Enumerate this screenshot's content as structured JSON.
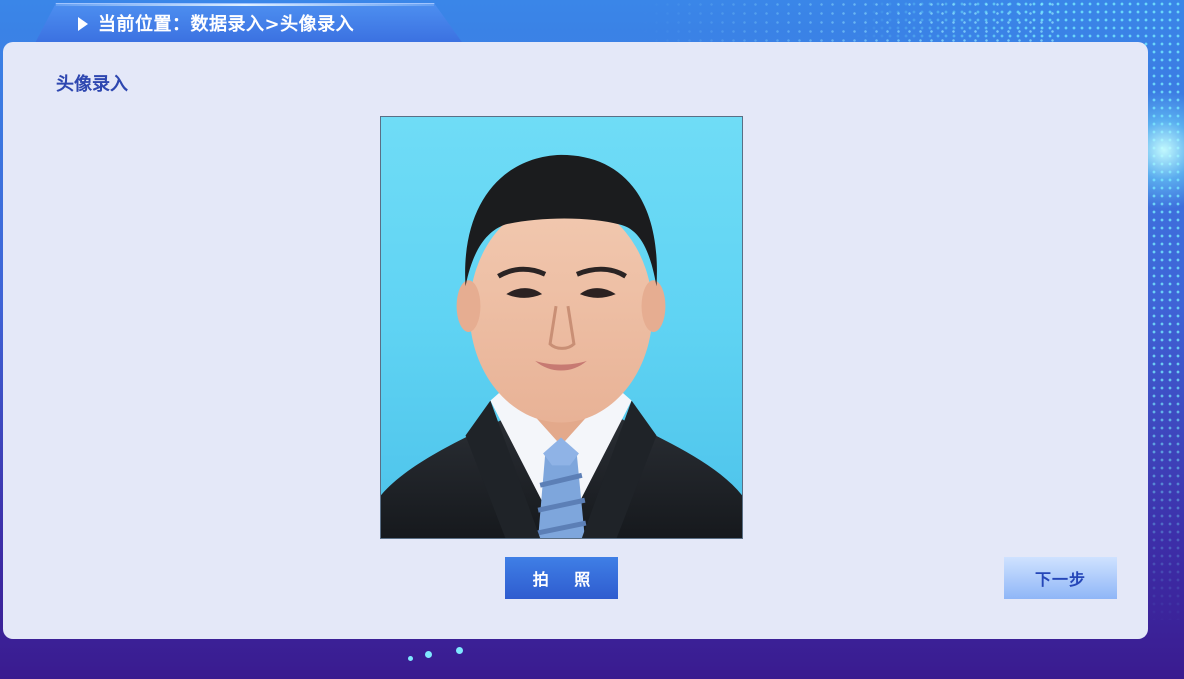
{
  "breadcrumb": {
    "text": "当前位置：数据录入>头像录入",
    "icon": "triangle-right-icon"
  },
  "panel": {
    "title": "头像录入"
  },
  "photo": {
    "description_icon": "portrait-photo"
  },
  "buttons": {
    "capture_label": "拍 照",
    "next_label": "下一步"
  },
  "colors": {
    "accent": "#2e47b0",
    "panel_bg": "#e4e8f8",
    "primary_button": "#3a6fe0",
    "secondary_button": "#a9c7fa"
  }
}
